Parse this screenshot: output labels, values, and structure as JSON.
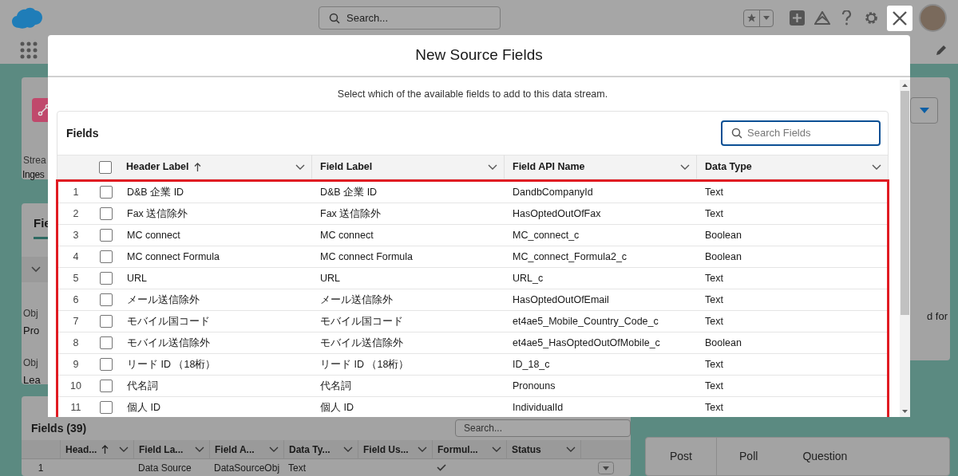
{
  "top_bar": {
    "search": {
      "placeholder": "Search..."
    }
  },
  "record_card": {
    "label": "Strea",
    "value": "Inges"
  },
  "details": {
    "tab": "Fie",
    "fields": [
      {
        "label": "Obj",
        "value": "Pro"
      },
      {
        "label": "Obj",
        "value": "Lea"
      }
    ]
  },
  "fields_list": {
    "title": "Fields (39)",
    "search": {
      "placeholder": "Search..."
    },
    "columns": [
      {
        "label": "Head...",
        "sorted": true
      },
      {
        "label": "Field La...",
        "sorted": false
      },
      {
        "label": "Field A...",
        "sorted": false
      },
      {
        "label": "Data Ty...",
        "sorted": false
      },
      {
        "label": "Field Us...",
        "sorted": false
      },
      {
        "label": "Formul...",
        "sorted": false
      },
      {
        "label": "Status",
        "sorted": false
      }
    ],
    "rows": [
      {
        "index": "1",
        "header": "",
        "field_label": "Data Source",
        "api_name": "DataSourceObj",
        "data_type": "Text",
        "usage": "",
        "formula": true,
        "status": ""
      }
    ]
  },
  "side_text": "d for",
  "publisher_tabs": [
    {
      "label": "Post",
      "selected": true
    },
    {
      "label": "Poll",
      "selected": false
    },
    {
      "label": "Question",
      "selected": false
    }
  ],
  "modal": {
    "title": "New Source Fields",
    "description": "Select which of the available fields to add to this data stream.",
    "card_title": "Fields",
    "search": {
      "placeholder": "Search Fields",
      "focused": true
    },
    "select_all_checked": false,
    "columns": [
      {
        "label": "Header Label",
        "sorted": true
      },
      {
        "label": "Field Label",
        "sorted": false
      },
      {
        "label": "Field API Name",
        "sorted": false
      },
      {
        "label": "Data Type",
        "sorted": false
      }
    ],
    "rows": [
      {
        "index": "1",
        "checked": false,
        "header_label": "D&B 企業 ID",
        "field_label": "D&B 企業 ID",
        "api_name": "DandbCompanyId",
        "data_type": "Text"
      },
      {
        "index": "2",
        "checked": false,
        "header_label": "Fax 送信除外",
        "field_label": "Fax 送信除外",
        "api_name": "HasOptedOutOfFax",
        "data_type": "Text"
      },
      {
        "index": "3",
        "checked": false,
        "header_label": "MC connect",
        "field_label": "MC connect",
        "api_name": "MC_connect_c",
        "data_type": "Boolean"
      },
      {
        "index": "4",
        "checked": false,
        "header_label": "MC connect Formula",
        "field_label": "MC connect Formula",
        "api_name": "MC_connect_Formula2_c",
        "data_type": "Boolean"
      },
      {
        "index": "5",
        "checked": false,
        "header_label": "URL",
        "field_label": "URL",
        "api_name": "URL_c",
        "data_type": "Text"
      },
      {
        "index": "6",
        "checked": false,
        "header_label": "メール送信除外",
        "field_label": "メール送信除外",
        "api_name": "HasOptedOutOfEmail",
        "data_type": "Text"
      },
      {
        "index": "7",
        "checked": false,
        "header_label": "モバイル国コード",
        "field_label": "モバイル国コード",
        "api_name": "et4ae5_Mobile_Country_Code_c",
        "data_type": "Text"
      },
      {
        "index": "8",
        "checked": false,
        "header_label": "モバイル送信除外",
        "field_label": "モバイル送信除外",
        "api_name": "et4ae5_HasOptedOutOfMobile_c",
        "data_type": "Boolean"
      },
      {
        "index": "9",
        "checked": false,
        "header_label": "リード ID （18桁）",
        "field_label": "リード ID （18桁）",
        "api_name": "ID_18_c",
        "data_type": "Text"
      },
      {
        "index": "10",
        "checked": false,
        "header_label": "代名詞",
        "field_label": "代名詞",
        "api_name": "Pronouns",
        "data_type": "Text"
      },
      {
        "index": "11",
        "checked": false,
        "header_label": "個人 ID",
        "field_label": "個人 ID",
        "api_name": "IndividualId",
        "data_type": "Text"
      }
    ]
  }
}
